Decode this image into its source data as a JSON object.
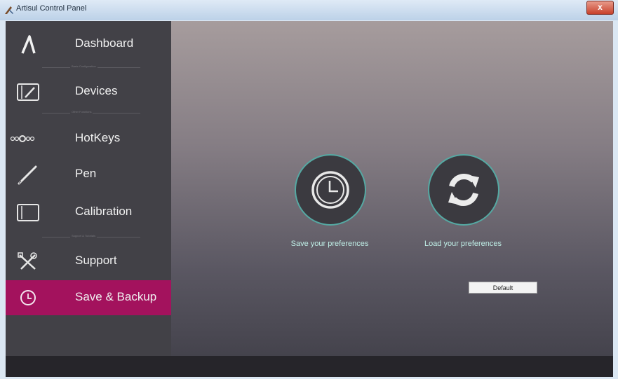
{
  "window": {
    "title": "Artisul Control Panel",
    "close_glyph": "x"
  },
  "sidebar": {
    "items": [
      {
        "label": "Dashboard",
        "icon": "artisul-logo-icon"
      },
      {
        "label": "Devices",
        "icon": "tablet-icon"
      },
      {
        "label": "HotKeys",
        "icon": "hotkeys-icon"
      },
      {
        "label": "Pen",
        "icon": "pen-icon"
      },
      {
        "label": "Calibration",
        "icon": "calibration-icon"
      },
      {
        "label": "Support",
        "icon": "tools-icon"
      },
      {
        "label": "Save & Backup",
        "icon": "clock-icon",
        "active": true
      }
    ],
    "dividers": [
      "Basic Configuration",
      "Other Functions",
      "Support & Tutorials"
    ]
  },
  "main": {
    "save": {
      "caption": "Save your preferences",
      "icon": "clock-icon"
    },
    "load": {
      "caption": "Load your preferences",
      "icon": "refresh-icon"
    },
    "default_label": "Default"
  },
  "colors": {
    "accent": "#a3125d",
    "ring": "#55a9a3",
    "sidebar": "#424147"
  }
}
